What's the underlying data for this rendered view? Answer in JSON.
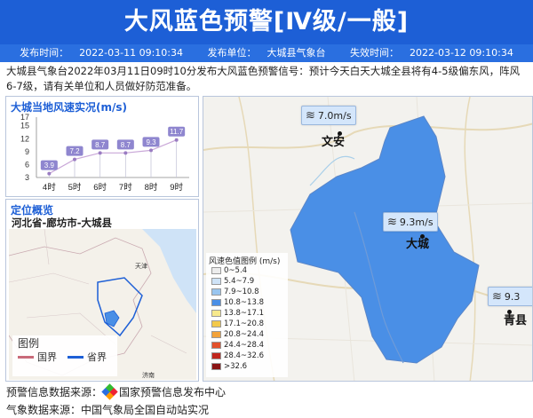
{
  "header": {
    "title": "大风蓝色预警[Ⅳ级/一般]"
  },
  "meta": {
    "publish_time_label": "发布时间：",
    "publish_time": "2022-03-11 09:10:34",
    "publisher_label": "发布单位：",
    "publisher": "大城县气象台",
    "expire_label": "失效时间：",
    "expire_time": "2022-03-12 09:10:34"
  },
  "description": "大城县气象台2022年03月11日09时10分发布大风蓝色预警信号：预计今天白天大城全县将有4-5级偏东风，阵风6-7级，请有关单位和人员做好防范准备。",
  "wind_panel": {
    "title": "大城当地风速实况(m/s)"
  },
  "chart_data": {
    "type": "line",
    "title": "大城当地风速实况(m/s)",
    "categories": [
      "4时",
      "5时",
      "6时",
      "7时",
      "8时",
      "9时"
    ],
    "values": [
      3.9,
      7.2,
      8.7,
      8.7,
      9.3,
      11.7
    ],
    "value_labels": [
      "3.9",
      "7.2",
      "8.7",
      "8.7",
      "9.3",
      "11.7"
    ],
    "y_ticks": [
      "3",
      "6",
      "9",
      "12",
      "15",
      "17"
    ],
    "ylim": [
      3,
      17
    ],
    "grid": false
  },
  "location_panel": {
    "title": "定位概览",
    "subtitle": "河北省-廊坊市-大城县",
    "map_labels": {
      "tianjin": "天津",
      "jinan": "济南"
    },
    "legend": {
      "title": "图例",
      "national_border": "国界",
      "province_border": "省界"
    }
  },
  "main_map": {
    "legend_title": "风速色值图例 (m/s)",
    "legend_items": [
      {
        "label": "0~5.4",
        "color": "#ececec"
      },
      {
        "label": "5.4~7.9",
        "color": "#cfe3f7"
      },
      {
        "label": "7.9~10.8",
        "color": "#99c5ef"
      },
      {
        "label": "10.8~13.8",
        "color": "#4a8fe6"
      },
      {
        "label": "13.8~17.1",
        "color": "#f7e98c"
      },
      {
        "label": "17.1~20.8",
        "color": "#f3c94a"
      },
      {
        "label": "20.8~24.4",
        "color": "#f2a23a"
      },
      {
        "label": "24.4~28.4",
        "color": "#e2512c"
      },
      {
        "label": "28.4~32.6",
        "color": "#c0261d"
      },
      {
        "label": ">32.6",
        "color": "#8a1414"
      }
    ],
    "stations": [
      {
        "name": "文安",
        "wind": "7.0m/s"
      },
      {
        "name": "大城",
        "wind": "9.3m/s"
      },
      {
        "name": "青县",
        "wind": "9.3"
      }
    ]
  },
  "footer": {
    "warning_source_label": "预警信息数据来源：",
    "warning_source": "国家预警信息发布中心",
    "weather_source_label": "气象数据来源：",
    "weather_source": "中国气象局全国自动站实况"
  },
  "colors": {
    "header_bg": "#1d5fd6",
    "region_fill": "#4a8fe6",
    "national_border": "#c96a7a",
    "province_border": "#1d5fd6"
  }
}
